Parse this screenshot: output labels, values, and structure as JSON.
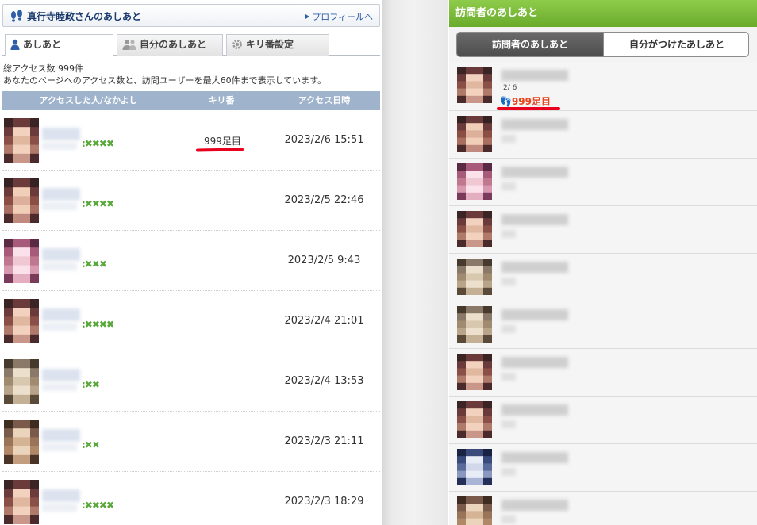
{
  "left": {
    "header": {
      "title": "真行寺睦政さんのあしあと",
      "profile_link": "プロフィールへ"
    },
    "tabs": [
      {
        "label": "あしあと",
        "icon": "person-icon"
      },
      {
        "label": "自分のあしあと",
        "icon": "people-icon"
      },
      {
        "label": "キリ番設定",
        "icon": "gear-icon"
      }
    ],
    "summary": {
      "line1": "総アクセス数 999件",
      "line2": "あなたのページへのアクセス数と、訪問ユーザーを最大60件まで表示しています。"
    },
    "table": {
      "headers": [
        "アクセスした人/なかよし",
        "キリ番",
        "アクセス日時"
      ],
      "rows": [
        {
          "clovers": ":✖✖✖✖",
          "kiri": "999足目",
          "date": "2023/2/6 15:51"
        },
        {
          "clovers": ":✖✖✖✖",
          "kiri": "",
          "date": "2023/2/5 22:46"
        },
        {
          "clovers": ":✖✖✖",
          "kiri": "",
          "date": "2023/2/5 9:43"
        },
        {
          "clovers": ":✖✖✖✖",
          "kiri": "",
          "date": "2023/2/4 21:01"
        },
        {
          "clovers": ":✖✖",
          "kiri": "",
          "date": "2023/2/4 13:53"
        },
        {
          "clovers": ":✖✖",
          "kiri": "",
          "date": "2023/2/3 21:11"
        },
        {
          "clovers": ":✖✖✖✖",
          "kiri": "",
          "date": "2023/2/3 18:29"
        }
      ]
    }
  },
  "right": {
    "header": {
      "title": "訪問者のあしあと"
    },
    "segments": [
      "訪問者のあしあと",
      "自分がつけたあしあと"
    ],
    "first_row": {
      "page": "2/ 6",
      "hit": "999足目"
    },
    "row_count": 10
  },
  "colors": {
    "header_green": "#7bbd3b",
    "table_header_blue": "#9fb3cc",
    "highlight_red": "#e8001e",
    "hit_orange": "#e8451e",
    "clover_green": "#59a83a"
  }
}
